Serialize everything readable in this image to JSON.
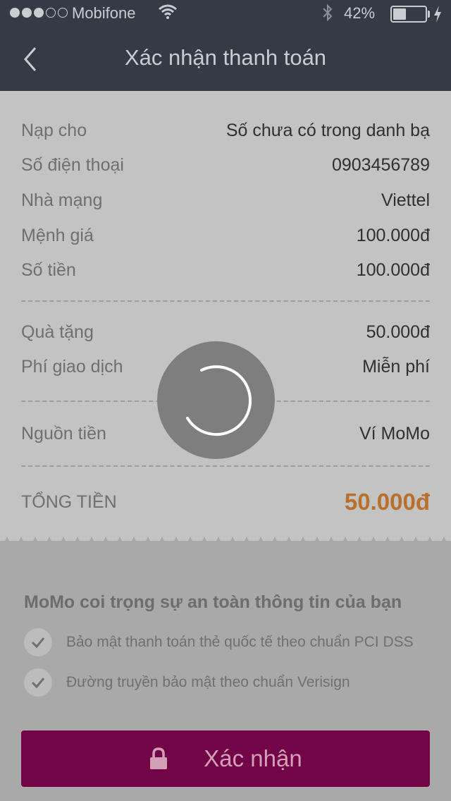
{
  "status_bar": {
    "signal_icon": "signal-dots-icon",
    "carrier": "Mobifone",
    "wifi_icon": "wifi-icon",
    "bluetooth_icon": "bluetooth-icon",
    "battery_percent": "42%",
    "battery_level": 0.42,
    "charging_icon": "bolt-icon"
  },
  "nav": {
    "back_icon": "chevron-left-icon",
    "title": "Xác nhận thanh toán"
  },
  "details": [
    {
      "label": "Nạp cho",
      "value": "Số chưa có trong danh bạ"
    },
    {
      "label": "Số điện thoại",
      "value": "0903456789"
    },
    {
      "label": "Nhà mạng",
      "value": "Viettel"
    },
    {
      "label": "Mệnh giá",
      "value": "100.000đ"
    },
    {
      "label": "Số tiền",
      "value": "100.000đ"
    }
  ],
  "extras": [
    {
      "label": "Quà tặng",
      "value": "50.000đ"
    },
    {
      "label": "Phí giao dịch",
      "value": "Miễn phí"
    }
  ],
  "source": {
    "label": "Nguồn tiền",
    "value": "Ví MoMo"
  },
  "total": {
    "label": "TỔNG TIỀN",
    "value": "50.000đ"
  },
  "security": {
    "title": "MoMo coi trọng sự an toàn thông tin của bạn",
    "items": [
      {
        "text": "Bảo mật thanh toán thẻ quốc tế theo chuẩn PCI DSS",
        "icon": "check-icon"
      },
      {
        "text": "Đường truyền bảo mật theo chuẩn Verisign",
        "icon": "check-icon"
      }
    ]
  },
  "confirm_button": {
    "label": "Xác nhận",
    "icon": "lock-icon"
  },
  "loading": {
    "icon": "spinner-icon"
  },
  "colors": {
    "navbar": "#343b47",
    "total_accent": "#b8702a",
    "confirm_button": "#720448"
  }
}
